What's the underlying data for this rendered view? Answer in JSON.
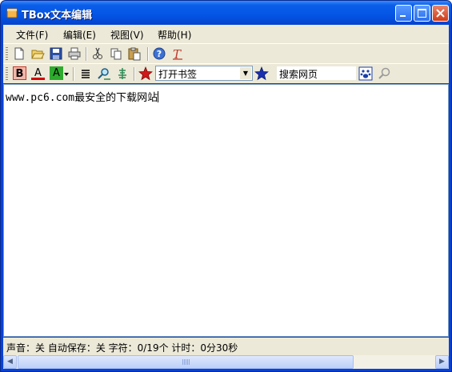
{
  "window": {
    "title": "TBox文本编辑"
  },
  "menu": {
    "items": [
      {
        "label": "文件(F)"
      },
      {
        "label": "编辑(E)"
      },
      {
        "label": "视图(V)"
      },
      {
        "label": "帮助(H)"
      }
    ]
  },
  "toolbar1": {
    "icons": [
      "new-file-icon",
      "open-folder-icon",
      "save-icon",
      "print-icon",
      "cut-icon",
      "copy-icon",
      "paste-icon",
      "help-icon",
      "clear-format-icon"
    ]
  },
  "toolbar2": {
    "bold_label": "B",
    "font_color_label": "A",
    "highlight_label": "A",
    "bookmark_selected": "打开书签",
    "search_placeholder": "搜索网页"
  },
  "editor": {
    "content": "www.pc6.com最安全的下载网站"
  },
  "status": {
    "text": "声音：关 自动保存：关 字符：0/19个 计时：0分30秒"
  },
  "colors": {
    "titlebar": "#0455e4",
    "chrome": "#ece9d8",
    "bold": "#c0392b",
    "font_color": "#d40000",
    "highlight": "#2eaa2e"
  }
}
